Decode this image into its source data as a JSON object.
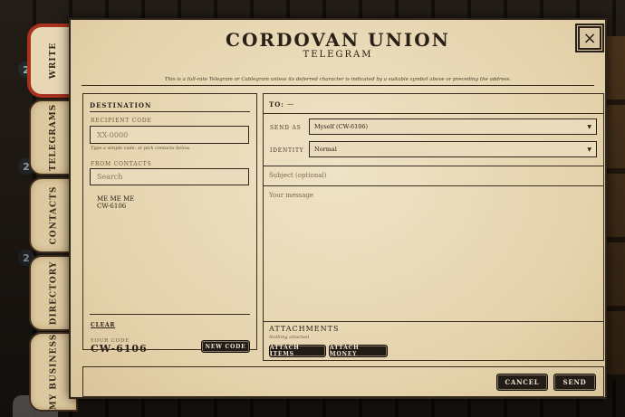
{
  "background": {
    "badges": [
      "2",
      "2",
      "2"
    ]
  },
  "tabs": [
    {
      "label": "WRITE",
      "active": true
    },
    {
      "label": "TELEGRAMS",
      "active": false
    },
    {
      "label": "CONTACTS",
      "active": false
    },
    {
      "label": "DIRECTORY",
      "active": false
    },
    {
      "label": "MY BUSINESS",
      "active": false
    }
  ],
  "header": {
    "title": "CORDOVAN UNION",
    "subtitle": "TELEGRAM",
    "close_icon": "×",
    "notice": "This is a full-rate Telegram or Cablegram unless its deferred character is indicated by a suitable symbol above or preceding the address."
  },
  "destination": {
    "heading": "DESTINATION",
    "recipient_label": "RECIPIENT CODE",
    "recipient_placeholder": "XX-0000",
    "hint": "Type a simple code, or pick contacts below.",
    "from_contacts_label": "FROM CONTACTS",
    "search_placeholder": "Search",
    "contacts": [
      {
        "name": "ME ME ME",
        "code": "CW-6106"
      }
    ],
    "clear_label": "CLEAR",
    "your_code_label": "YOUR CODE",
    "your_code": "CW-6106",
    "new_code_label": "NEW CODE"
  },
  "compose": {
    "to_label": "TO:",
    "to_value": "—",
    "send_as_label": "SEND AS",
    "send_as_value": "Myself (CW-6106)",
    "identity_label": "IDENTITY",
    "identity_value": "Normal",
    "dropdown_arrow": "▼",
    "subject_placeholder": "Subject (optional)",
    "message_placeholder": "Your message",
    "attachments_heading": "ATTACHMENTS",
    "attachments_empty": "Nothing attached",
    "attach_items_label": "ATTACH ITEMS",
    "attach_money_label": "ATTACH MONEY"
  },
  "footer": {
    "cancel_label": "CANCEL",
    "send_label": "SEND"
  }
}
